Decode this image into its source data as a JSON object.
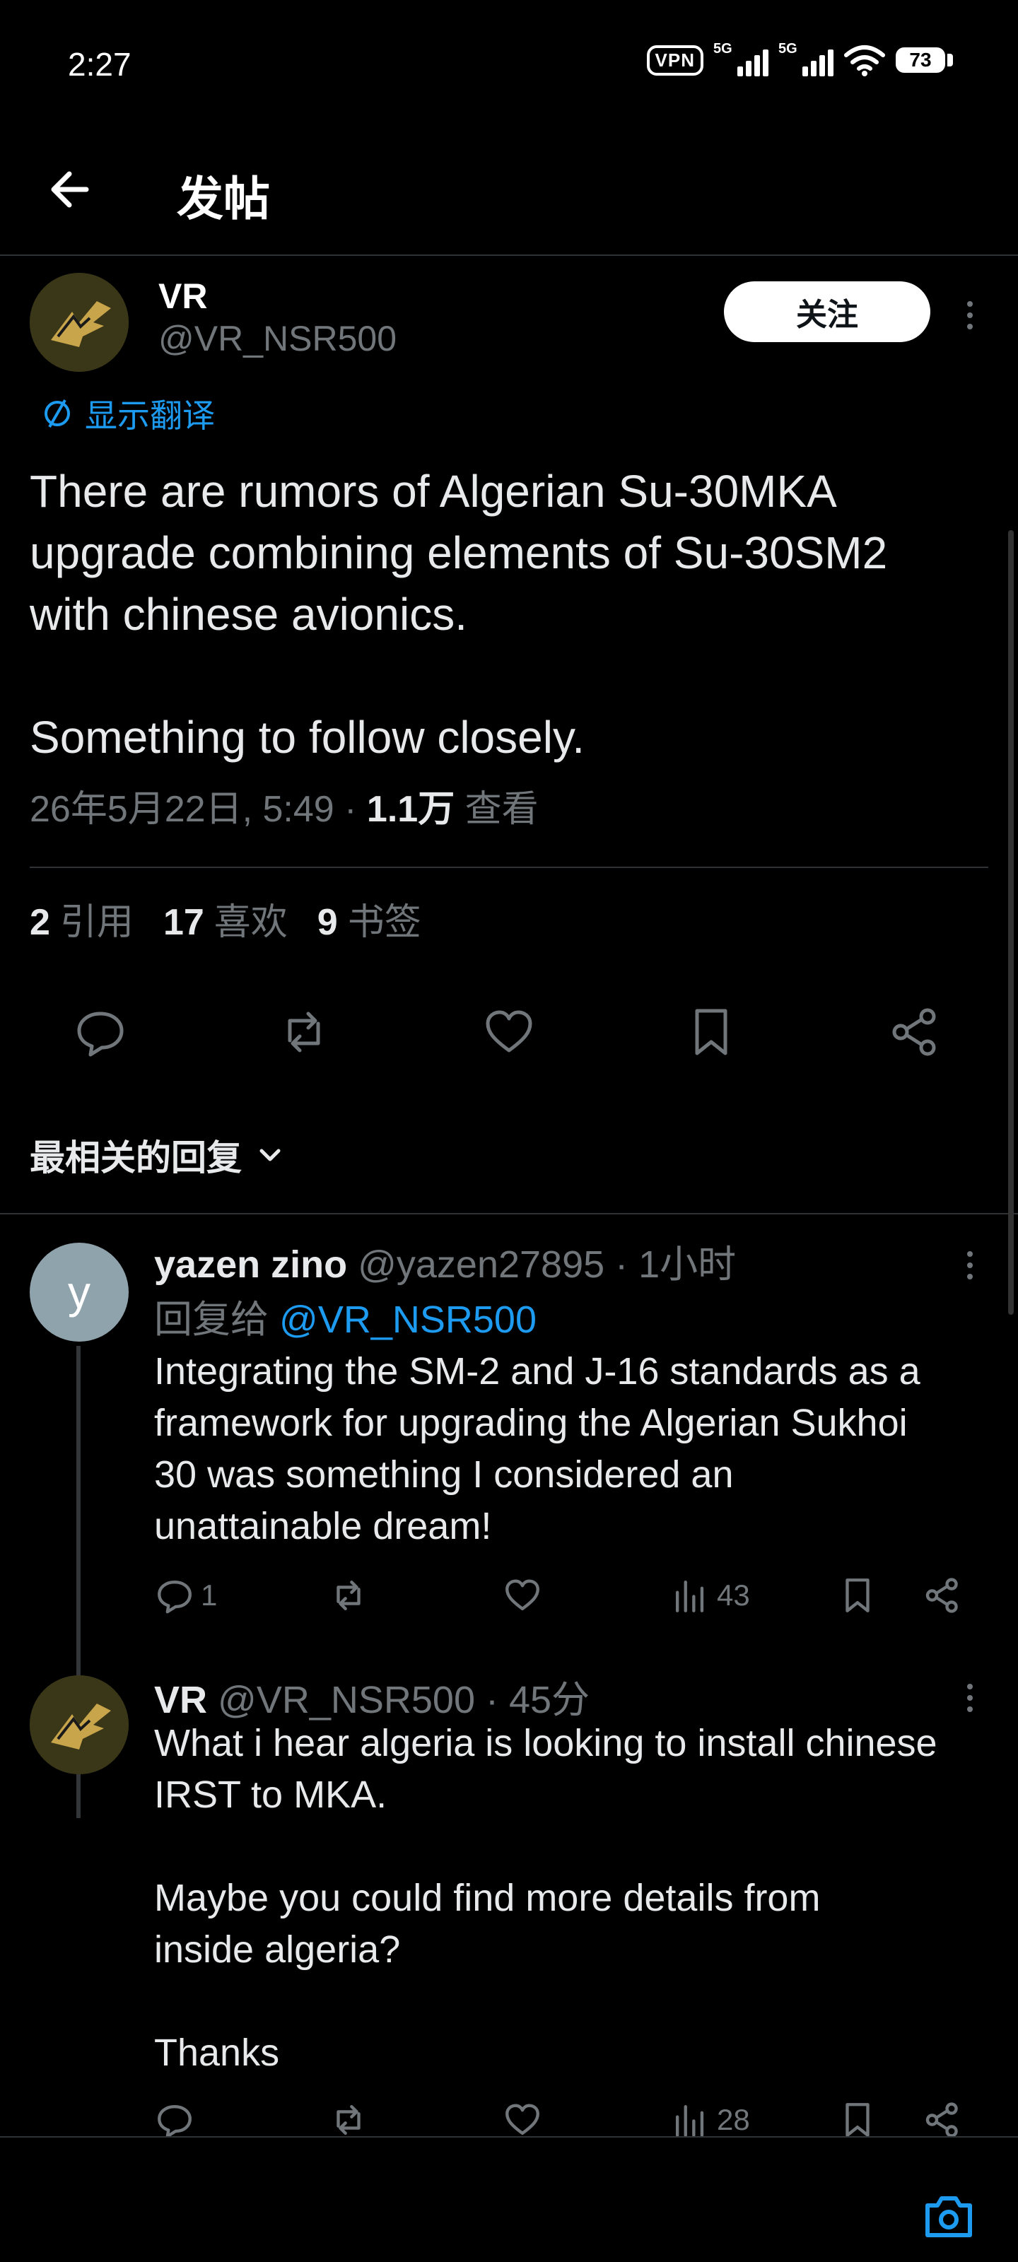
{
  "status_bar": {
    "time": "2:27",
    "vpn": "VPN",
    "net1": "5G",
    "net2": "5G",
    "battery": "73"
  },
  "header": {
    "title": "发帖"
  },
  "post": {
    "author_name": "VR",
    "author_handle": "@VR_NSR500",
    "follow_label": "关注",
    "translate_label": "显示翻译",
    "text": "There are rumors of Algerian Su-30MKA\nupgrade combining elements of Su-30SM2\nwith chinese avionics.\n\nSomething to follow closely.",
    "date": "26年5月22日, 5:49 · ",
    "views_count": "1.1万",
    "views_label": " 查看",
    "stats": {
      "quotes_count": "2",
      "quotes_label": "引用",
      "likes_count": "17",
      "likes_label": "喜欢",
      "bookmarks_count": "9",
      "bookmarks_label": "书签"
    }
  },
  "sort_label": "最相关的回复",
  "replies": [
    {
      "avatar_letter": "y",
      "name": "yazen zino",
      "meta": " @yazen27895 · 1小时",
      "reply_to_label": "回复给 ",
      "reply_to_handle": "@VR_NSR500",
      "text": "Integrating the SM-2 and J-16 standards as a\nframework for upgrading the Algerian Sukhoi\n30 was something I considered an\nunattainable dream!",
      "reply_count": "1",
      "views": "43"
    },
    {
      "name": "VR",
      "meta": " @VR_NSR500 · 45分",
      "text": "What i hear algeria is looking to install chinese\nIRST to MKA.\n\nMaybe you could find more details from\ninside algeria?\n\nThanks",
      "views": "28"
    }
  ],
  "colors": {
    "accent": "#1d9bf0",
    "muted": "#71767b",
    "text": "#e7e9ea",
    "divider": "#2f3336"
  }
}
